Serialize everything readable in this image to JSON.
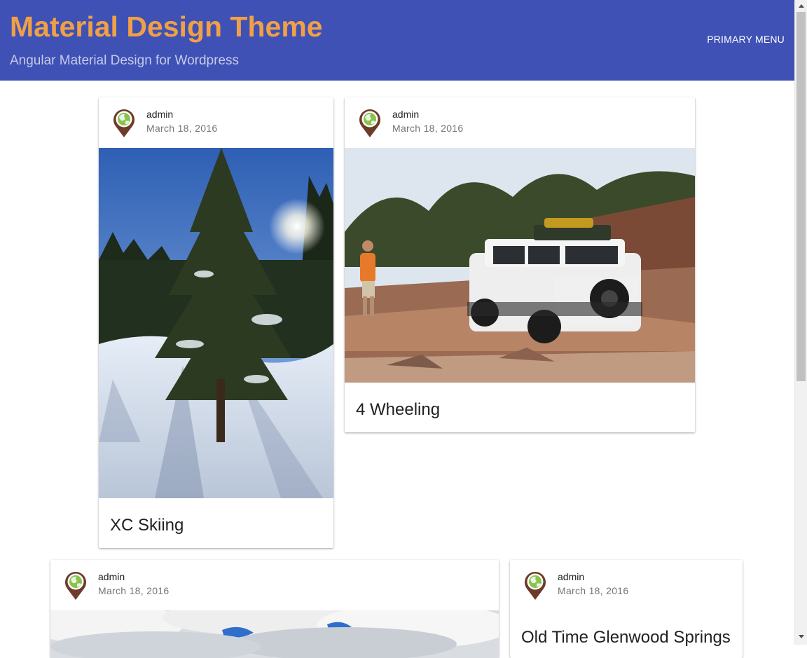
{
  "site": {
    "title": "Material Design Theme",
    "tagline": "Angular Material Design for Wordpress",
    "primary_menu": "PRIMARY MENU"
  },
  "colors": {
    "header_bg": "#3f51b5",
    "title_color": "#f0a046",
    "tagline_color": "#c5cae9"
  },
  "posts": [
    {
      "author": "admin",
      "date": "March 18, 2016",
      "title": "XC Skiing",
      "image": "snowy-pine-tree-forest-photo"
    },
    {
      "author": "admin",
      "date": "March 18, 2016",
      "title": "4 Wheeling",
      "image": "white-suv-on-red-rocks-photo"
    },
    {
      "author": "admin",
      "date": "March 18, 2016",
      "title": "",
      "image": "cloudy-blue-sky-photo"
    },
    {
      "author": "admin",
      "date": "March 18, 2016",
      "title": "Old Time Glenwood Springs",
      "image": ""
    }
  ]
}
